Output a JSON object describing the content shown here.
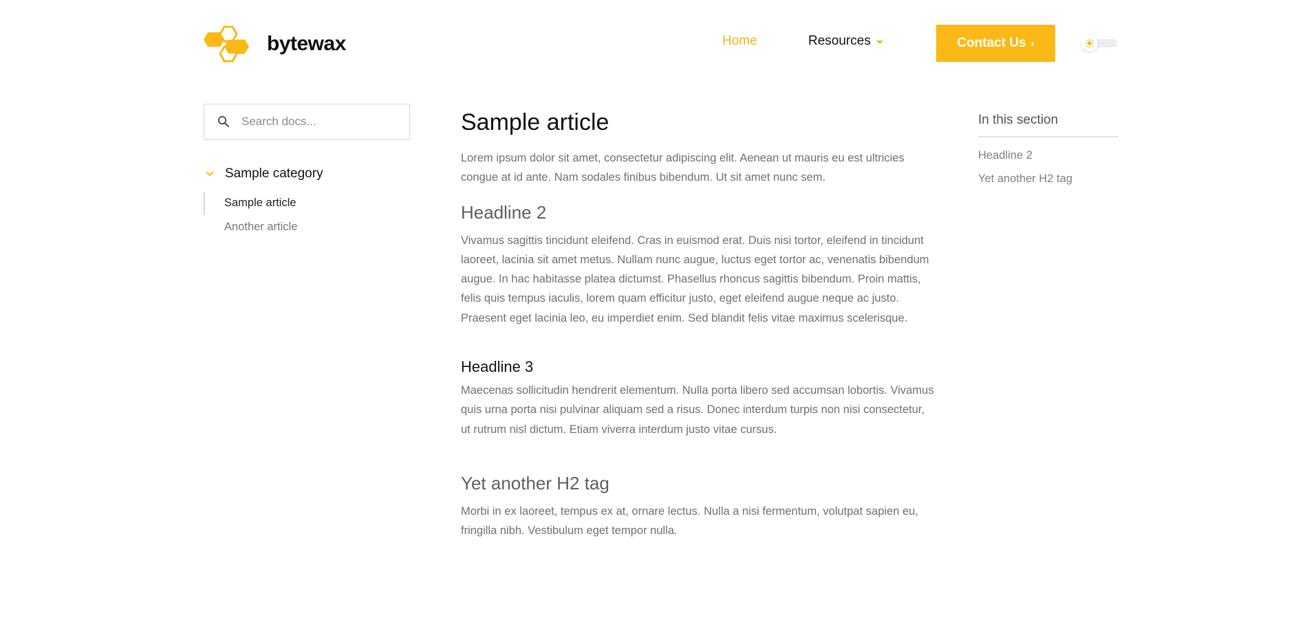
{
  "header": {
    "brand": "bytewax",
    "nav": {
      "home": "Home",
      "resources": "Resources"
    },
    "contact_label": "Contact Us",
    "contact_chevron": "›",
    "accent_color": "#f5b50f",
    "button_color": "#fbb917",
    "theme_toggle_icon": "sun-icon"
  },
  "sidebar": {
    "search_placeholder": "Search docs...",
    "category": "Sample category",
    "items": [
      {
        "label": "Sample article",
        "active": true
      },
      {
        "label": "Another article",
        "active": false
      }
    ]
  },
  "article": {
    "title": "Sample article",
    "intro": "Lorem ipsum dolor sit amet, consectetur adipiscing elit. Aenean ut mauris eu est ultricies congue at id ante. Nam sodales finibus bibendum. Ut sit amet nunc sem.",
    "sections": [
      {
        "heading": "Headline 2",
        "body": "Vivamus sagittis tincidunt eleifend. Cras in euismod erat. Duis nisi tortor, eleifend in tincidunt laoreet, lacinia sit amet metus. Nullam nunc augue, luctus eget tortor ac, venenatis bibendum augue. In hac habitasse platea dictumst. Phasellus rhoncus sagittis bibendum. Proin mattis, felis quis tempus iaculis, lorem quam efficitur justo, eget eleifend augue neque ac justo. Praesent eget lacinia leo, eu imperdiet enim. Sed blandit felis vitae maximus scelerisque."
      },
      {
        "heading": "Headline 3",
        "body": "Maecenas sollicitudin hendrerit elementum. Nulla porta libero sed accumsan lobortis. Vivamus quis urna porta nisi pulvinar aliquam sed a risus. Donec interdum turpis non nisi consectetur, ut rutrum nisl dictum. Etiam viverra interdum justo vitae cursus."
      },
      {
        "heading": "Yet another H2 tag",
        "body": "Morbi in ex laoreet, tempus ex at, ornare lectus. Nulla a nisi fermentum, volutpat sapien eu, fringilla nibh. Vestibulum eget tempor nulla."
      }
    ]
  },
  "toc": {
    "title": "In this section",
    "links": [
      "Headline 2",
      "Yet another H2 tag"
    ]
  }
}
